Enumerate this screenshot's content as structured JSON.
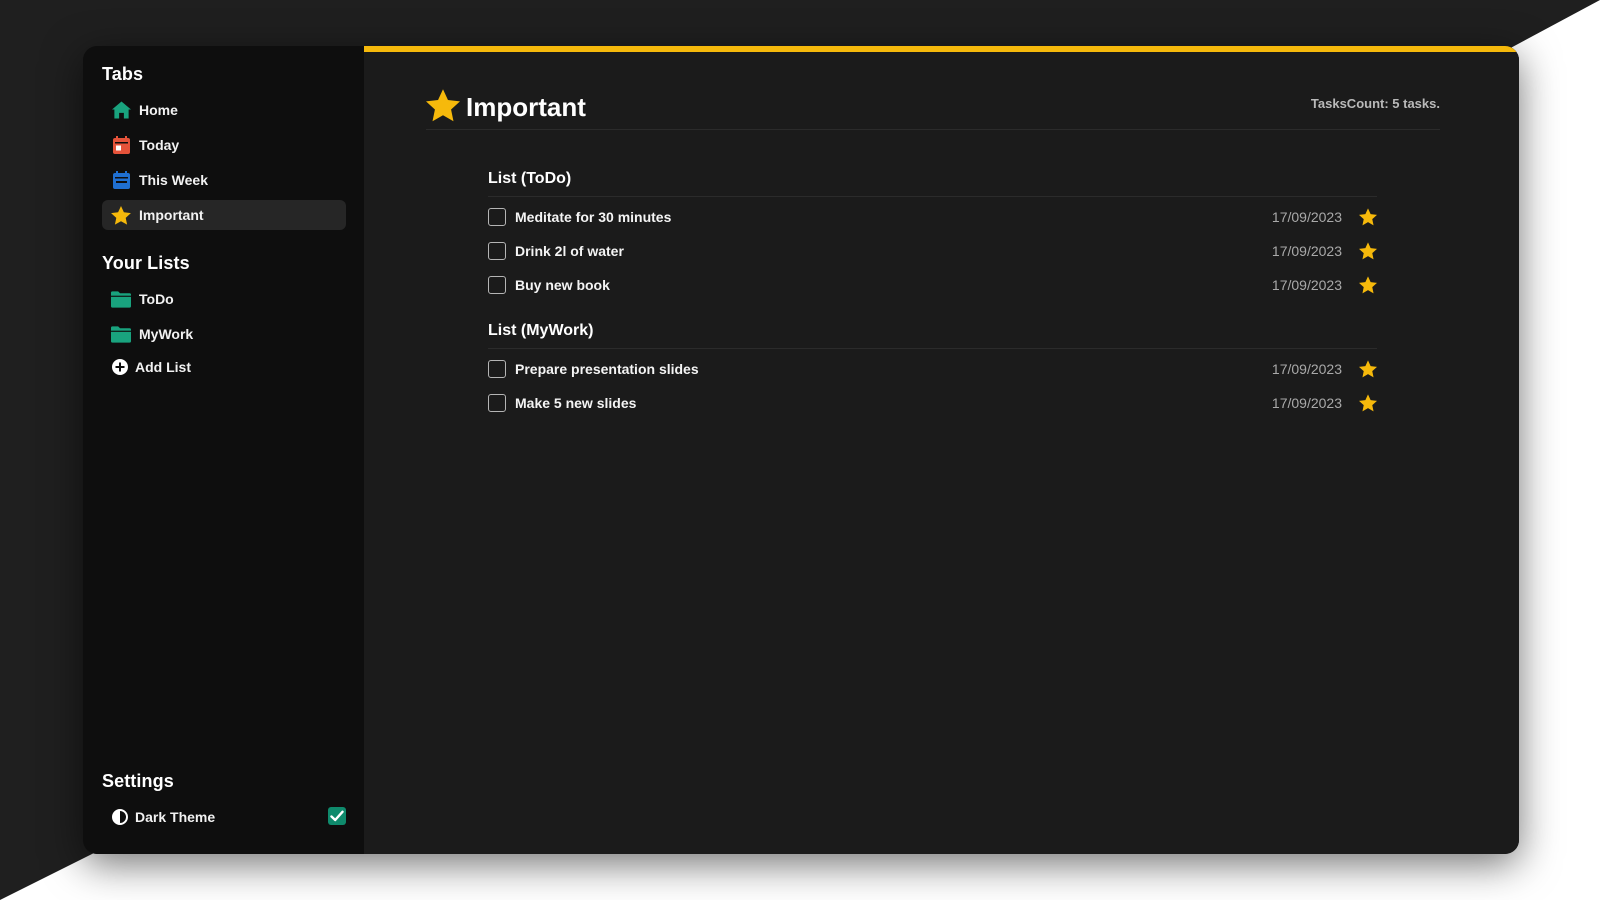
{
  "sidebar": {
    "tabs_heading": "Tabs",
    "tabs": [
      {
        "label": "Home",
        "icon": "home-icon",
        "color": "#19a37e"
      },
      {
        "label": "Today",
        "icon": "calendar-today-icon",
        "color": "#e5533a"
      },
      {
        "label": "This Week",
        "icon": "calendar-week-icon",
        "color": "#1f6fd1"
      },
      {
        "label": "Important",
        "icon": "star-icon",
        "color": "#f6b90b",
        "active": true
      }
    ],
    "lists_heading": "Your Lists",
    "lists": [
      {
        "label": "ToDo",
        "icon": "folder-icon",
        "color": "#19a37e"
      },
      {
        "label": "MyWork",
        "icon": "folder-icon",
        "color": "#19a37e"
      }
    ],
    "add_list_label": "Add List",
    "settings_heading": "Settings",
    "dark_theme_label": "Dark Theme",
    "dark_theme_checked": true
  },
  "main": {
    "title": "Important",
    "tasks_count": "TasksCount: 5 tasks.",
    "accent_color": "#f6b90b",
    "groups": [
      {
        "title": "List (ToDo)",
        "tasks": [
          {
            "label": "Meditate for 30 minutes",
            "date": "17/09/2023",
            "important": true,
            "done": false
          },
          {
            "label": "Drink 2l of water",
            "date": "17/09/2023",
            "important": true,
            "done": false
          },
          {
            "label": "Buy new book",
            "date": "17/09/2023",
            "important": true,
            "done": false
          }
        ]
      },
      {
        "title": "List (MyWork)",
        "tasks": [
          {
            "label": "Prepare presentation slides",
            "date": "17/09/2023",
            "important": true,
            "done": false
          },
          {
            "label": "Make 5 new slides",
            "date": "17/09/2023",
            "important": true,
            "done": false
          }
        ]
      }
    ]
  }
}
